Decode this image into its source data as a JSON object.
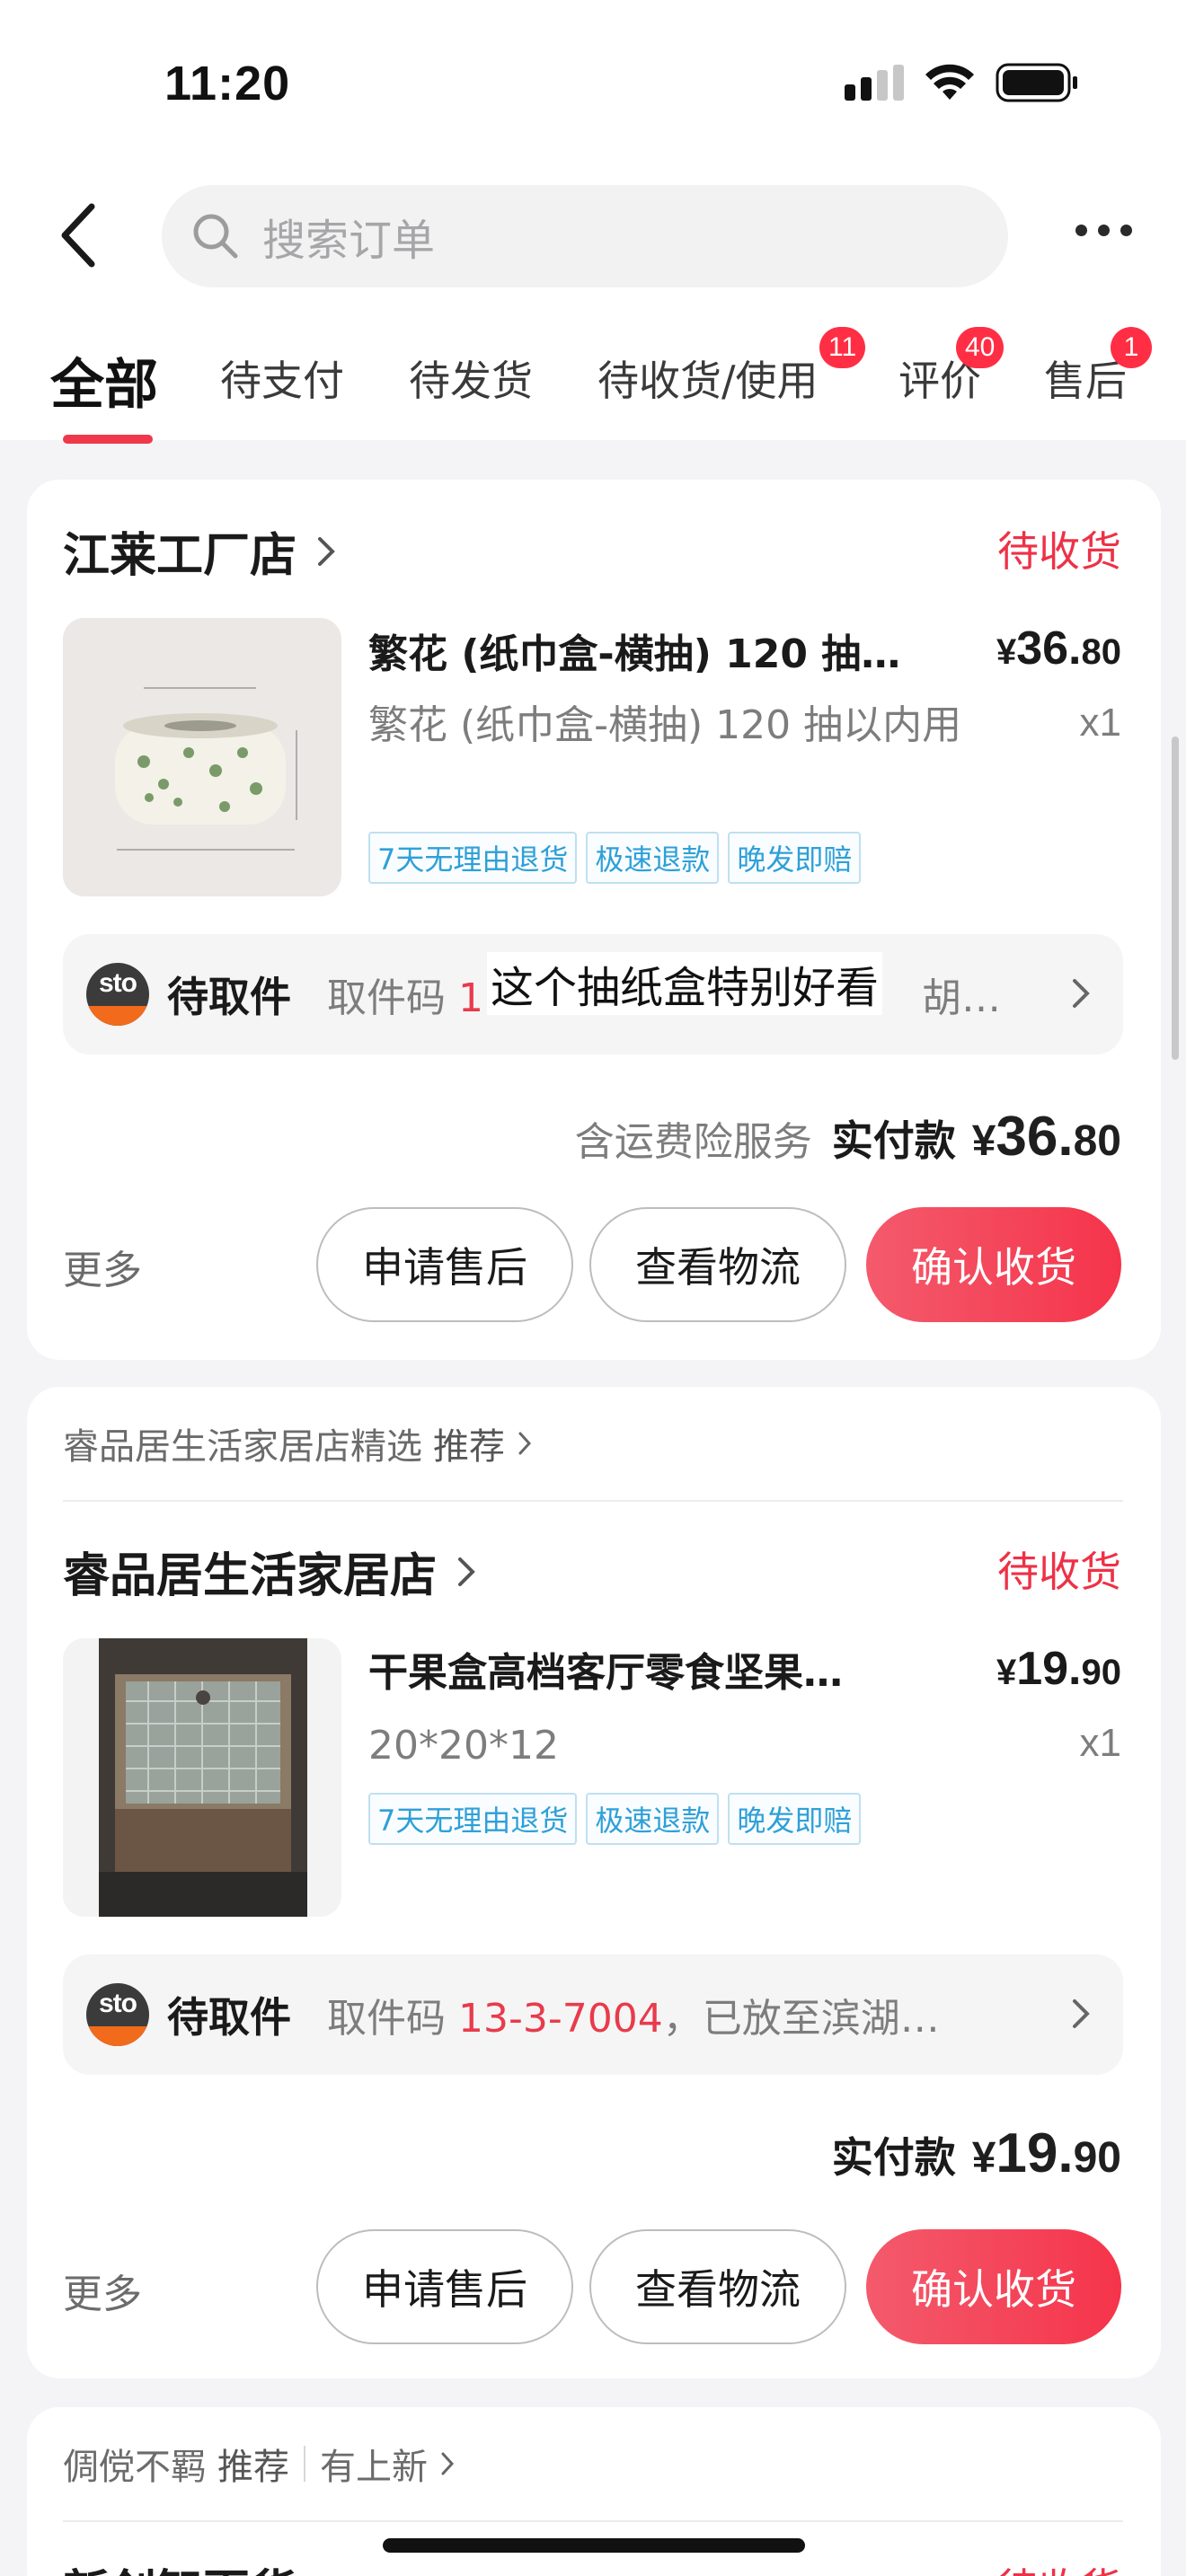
{
  "status_bar": {
    "time": "11:20"
  },
  "search": {
    "placeholder": "搜索订单"
  },
  "tabs": [
    {
      "label": "全部",
      "badge": ""
    },
    {
      "label": "待支付",
      "badge": ""
    },
    {
      "label": "待发货",
      "badge": ""
    },
    {
      "label": "待收货/使用",
      "badge": "11"
    },
    {
      "label": "评价",
      "badge": "40"
    },
    {
      "label": "售后",
      "badge": "1"
    }
  ],
  "orders": [
    {
      "recommend": "",
      "shop": "江莱工厂店",
      "status": "待收货",
      "product": {
        "title": "繁花 (纸巾盒-横抽) 120 抽…",
        "spec": "繁花 (纸巾盒-横抽) 120 抽以内用",
        "price_yen": "¥",
        "price_int": "36.",
        "price_dec": "80",
        "qty": "x1",
        "tags": [
          "7天无理由退货",
          "极速退款",
          "晚发即赔"
        ]
      },
      "pickup": {
        "label": "待取件",
        "prefix": "取件码 ",
        "code": "1",
        "rest": "胡…",
        "overlay_caption": "这个抽纸盒特别好看"
      },
      "payment": {
        "note": "含运费险服务",
        "label": "实付款",
        "yen": "¥",
        "int": "36.",
        "dec": "80"
      },
      "more": "更多",
      "buttons": {
        "after_sale": "申请售后",
        "logistics": "查看物流",
        "confirm": "确认收货"
      }
    },
    {
      "recommend": "睿品居生活家居店精选",
      "recommend_tag": "推荐",
      "shop": "睿品居生活家居店",
      "status": "待收货",
      "product": {
        "title": "干果盒高档客厅零食坚果…",
        "spec": "20*20*12",
        "price_yen": "¥",
        "price_int": "19.",
        "price_dec": "90",
        "qty": "x1",
        "tags": [
          "7天无理由退货",
          "极速退款",
          "晚发即赔"
        ]
      },
      "pickup": {
        "label": "待取件",
        "prefix": "取件码 ",
        "code": "13-3-7004",
        "rest": "，已放至滨湖…"
      },
      "payment": {
        "note": "",
        "label": "实付款",
        "yen": "¥",
        "int": "19.",
        "dec": "90"
      },
      "more": "更多",
      "buttons": {
        "after_sale": "申请售后",
        "logistics": "查看物流",
        "confirm": "确认收货"
      }
    },
    {
      "recommend": "倜傥不羁",
      "recommend_tag": "推荐",
      "recommend_extra": "有上新",
      "shop": "新创智百货",
      "status": "待收货"
    }
  ],
  "colors": {
    "accent": "#f5344b",
    "tag_blue": "#2ea0d8",
    "background": "#f4f4f6"
  },
  "icons": [
    "back-arrow-icon",
    "search-icon",
    "more-dots-icon",
    "chevron-right-icon",
    "sto-express-logo",
    "signal-icon",
    "wifi-icon",
    "battery-icon"
  ]
}
